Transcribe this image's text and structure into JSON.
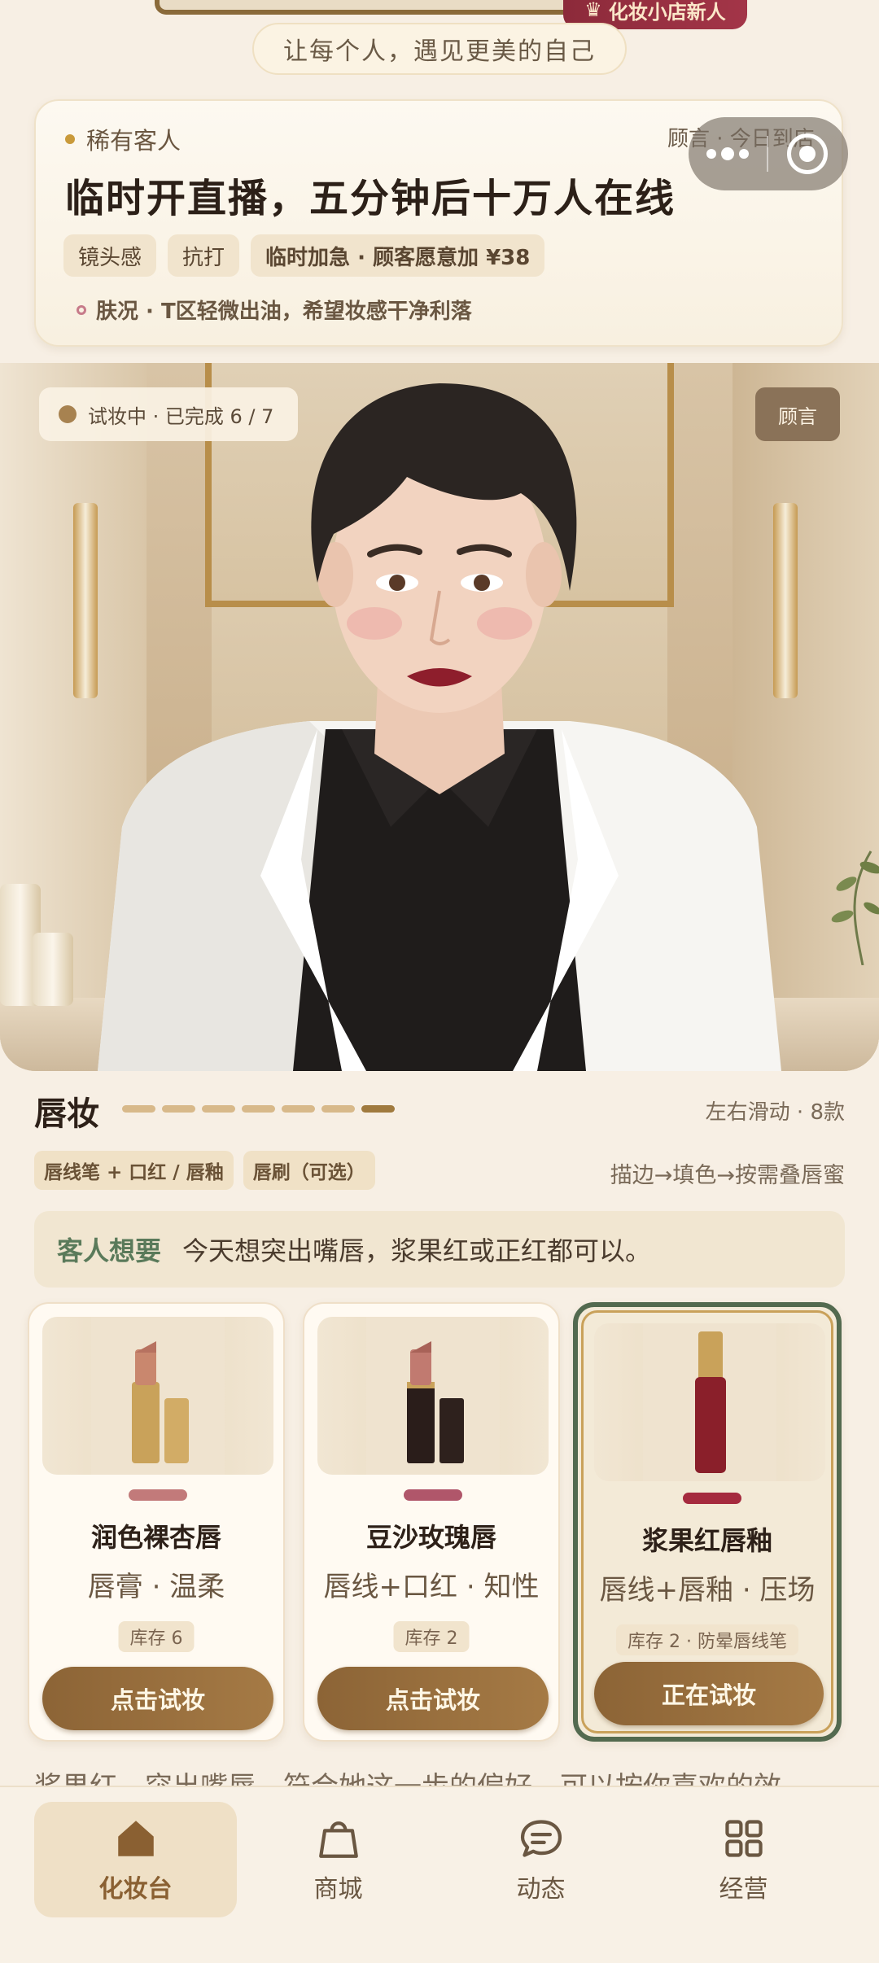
{
  "banner": {
    "vip_label": "化妆小店新人",
    "slogan": "让每个人，遇见更美的自己"
  },
  "customer": {
    "tag": "稀有客人",
    "title": "临时开直播，五分钟后十万人在线",
    "chips": [
      "镜头感",
      "抗打",
      "临时加急 · 顾客愿意加 ¥38"
    ],
    "note": "肤况 · T区轻微出油，希望妆感干净利落",
    "advisor_notice": "顾言 · 今日到店"
  },
  "hero": {
    "progress": "试妆中 · 已完成 6 / 7",
    "advisor_button": "顾言",
    "steps_done": 6,
    "steps_total": 7
  },
  "section": {
    "title": "唇妆",
    "swipe_hint": "左右滑动 · 8款",
    "tools": [
      "唇线笔 + 口红 / 唇釉",
      "唇刷（可选）"
    ],
    "method": "描边→填色→按需叠唇蜜",
    "request_label": "客人想要",
    "request_text": "今天想突出嘴唇，浆果红或正红都可以。"
  },
  "products": [
    {
      "name": "润色裸杏唇",
      "desc": "唇膏 · 温柔",
      "stock": "库存 6",
      "button": "点击试妆",
      "swatch": "#c27a7a",
      "selected": false
    },
    {
      "name": "豆沙玫瑰唇",
      "desc": "唇线+口红 · 知性",
      "stock": "库存 2",
      "button": "点击试妆",
      "swatch": "#b0566a",
      "selected": false
    },
    {
      "name": "浆果红唇釉",
      "desc": "唇线+唇釉 · 压场",
      "stock": "库存 2 · 防晕唇线笔",
      "button": "正在试妆",
      "swatch": "#a52a3e",
      "selected": true
    }
  ],
  "reply_preview": "浆果红，突出嘴唇，符合她这一步的偏好，可以按你喜欢的效",
  "nav": [
    {
      "label": "化妆台",
      "icon": "home-icon",
      "active": true
    },
    {
      "label": "商城",
      "icon": "bag-icon",
      "active": false
    },
    {
      "label": "动态",
      "icon": "chat-icon",
      "active": false
    },
    {
      "label": "经营",
      "icon": "grid-icon",
      "active": false
    }
  ]
}
